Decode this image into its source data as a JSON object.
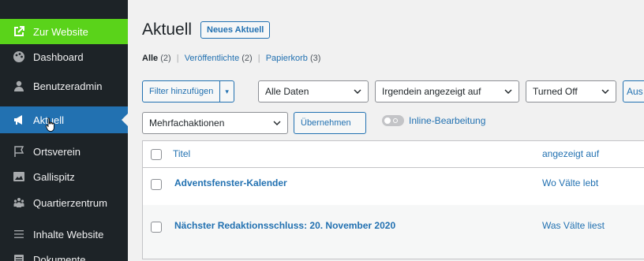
{
  "sidebar": {
    "items": [
      {
        "label": "Zur Website",
        "icon": "external-link-icon"
      },
      {
        "label": "Dashboard",
        "icon": "palette-icon"
      },
      {
        "label": "Benutzeradmin",
        "icon": "user-icon"
      },
      {
        "label": "Aktuell",
        "icon": "megaphone-icon"
      },
      {
        "label": "Ortsverein",
        "icon": "flag-icon"
      },
      {
        "label": "Gallispitz",
        "icon": "image-icon"
      },
      {
        "label": "Quartierzentrum",
        "icon": "groups-icon"
      },
      {
        "label": "Inhalte Website",
        "icon": "list-icon"
      },
      {
        "label": "Dokumente",
        "icon": "document-icon"
      }
    ]
  },
  "header": {
    "title": "Aktuell",
    "new_button": "Neues Aktuell"
  },
  "subsubsub": {
    "all_label": "Alle",
    "all_count": "(2)",
    "published_label": "Veröffentlichte",
    "published_count": "(2)",
    "trash_label": "Papierkorb",
    "trash_count": "(3)",
    "separator": "|"
  },
  "filters": {
    "add_filter": "Filter hinzufügen",
    "split_arrow": "▾",
    "dates": "Alle Daten",
    "shown_on": "Irgendein angezeigt auf",
    "turned": "Turned Off",
    "more": "Aus"
  },
  "bulk": {
    "actions": "Mehrfachaktionen",
    "apply": "Übernehmen",
    "inline_edit": "Inline-Bearbeitung"
  },
  "table": {
    "columns": {
      "title": "Titel",
      "shown_on": "angezeigt auf"
    },
    "rows": [
      {
        "title": "Adventsfenster-Kalender",
        "shown_on": "Wo Välte lebt"
      },
      {
        "title": "Nächster Redaktionsschluss: 20. November 2020",
        "shown_on": "Was Välte liest"
      }
    ]
  },
  "colors": {
    "sidebar_bg": "#1d2327",
    "accent_green": "#5ad31a",
    "active_blue": "#2271b1",
    "link_blue": "#2271b1"
  }
}
